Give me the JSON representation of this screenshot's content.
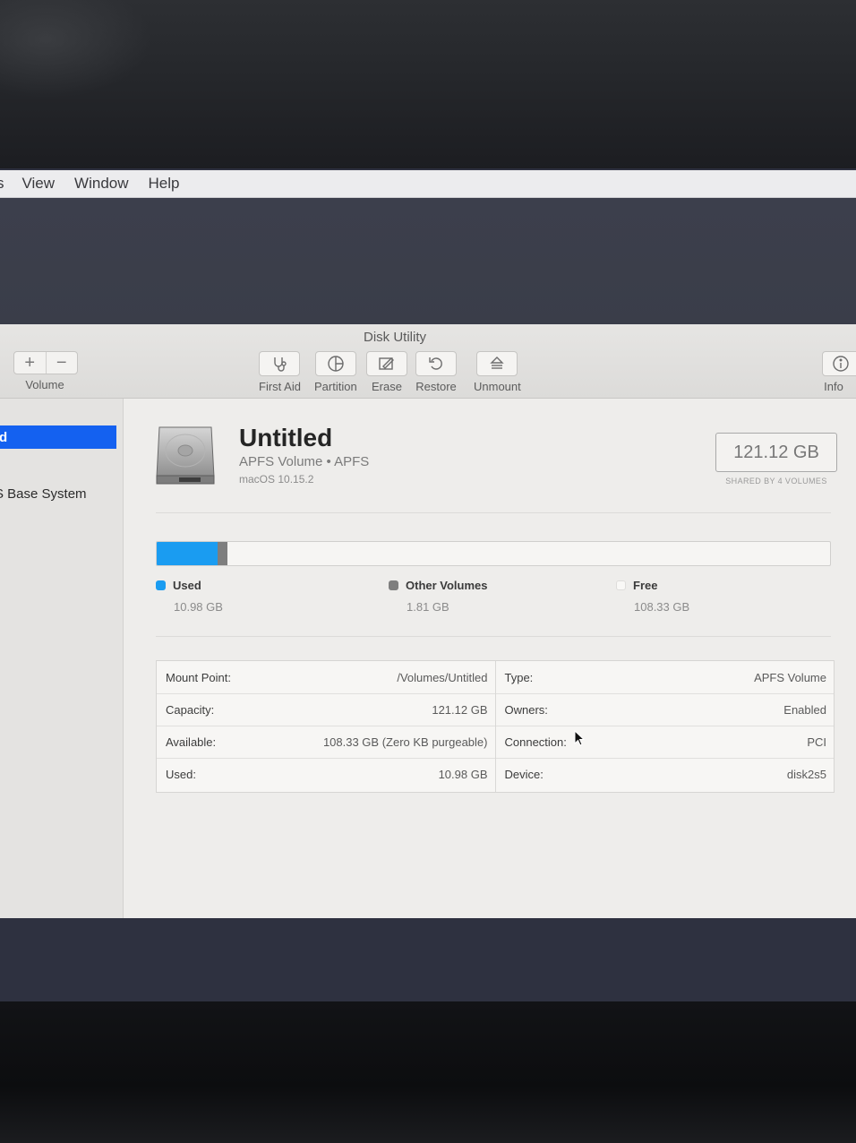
{
  "menubar": {
    "items": [
      "s",
      "View",
      "Window",
      "Help"
    ]
  },
  "window": {
    "title": "Disk Utility"
  },
  "toolbar": {
    "volume": {
      "add": "+",
      "remove": "−",
      "label": "Volume"
    },
    "first_aid": "First Aid",
    "partition": "Partition",
    "erase": "Erase",
    "restore": "Restore",
    "unmount": "Unmount",
    "info": "Info"
  },
  "sidebar": {
    "selected_label": "d",
    "items": [
      {
        "label": "S Base System"
      }
    ]
  },
  "volume": {
    "name": "Untitled",
    "subtitle": "APFS Volume • APFS",
    "os": "macOS 10.15.2",
    "capacity": "121.12 GB",
    "capacity_caption": "SHARED BY 4 VOLUMES"
  },
  "usage": {
    "used": {
      "label": "Used",
      "value": "10.98 GB",
      "fraction": 0.0907,
      "color": "#1a9cf1"
    },
    "other": {
      "label": "Other Volumes",
      "value": "1.81 GB",
      "fraction": 0.0149,
      "color": "#7e7e7e"
    },
    "free": {
      "label": "Free",
      "value": "108.33 GB",
      "fraction": 0.8944,
      "color": "#f6f5f3"
    }
  },
  "info": {
    "left": [
      {
        "label": "Mount Point:",
        "value": "/Volumes/Untitled"
      },
      {
        "label": "Capacity:",
        "value": "121.12 GB"
      },
      {
        "label": "Available:",
        "value": "108.33 GB (Zero KB purgeable)"
      },
      {
        "label": "Used:",
        "value": "10.98 GB"
      }
    ],
    "right": [
      {
        "label": "Type:",
        "value": "APFS Volume"
      },
      {
        "label": "Owners:",
        "value": "Enabled"
      },
      {
        "label": "Connection:",
        "value": "PCI"
      },
      {
        "label": "Device:",
        "value": "disk2s5"
      }
    ]
  }
}
